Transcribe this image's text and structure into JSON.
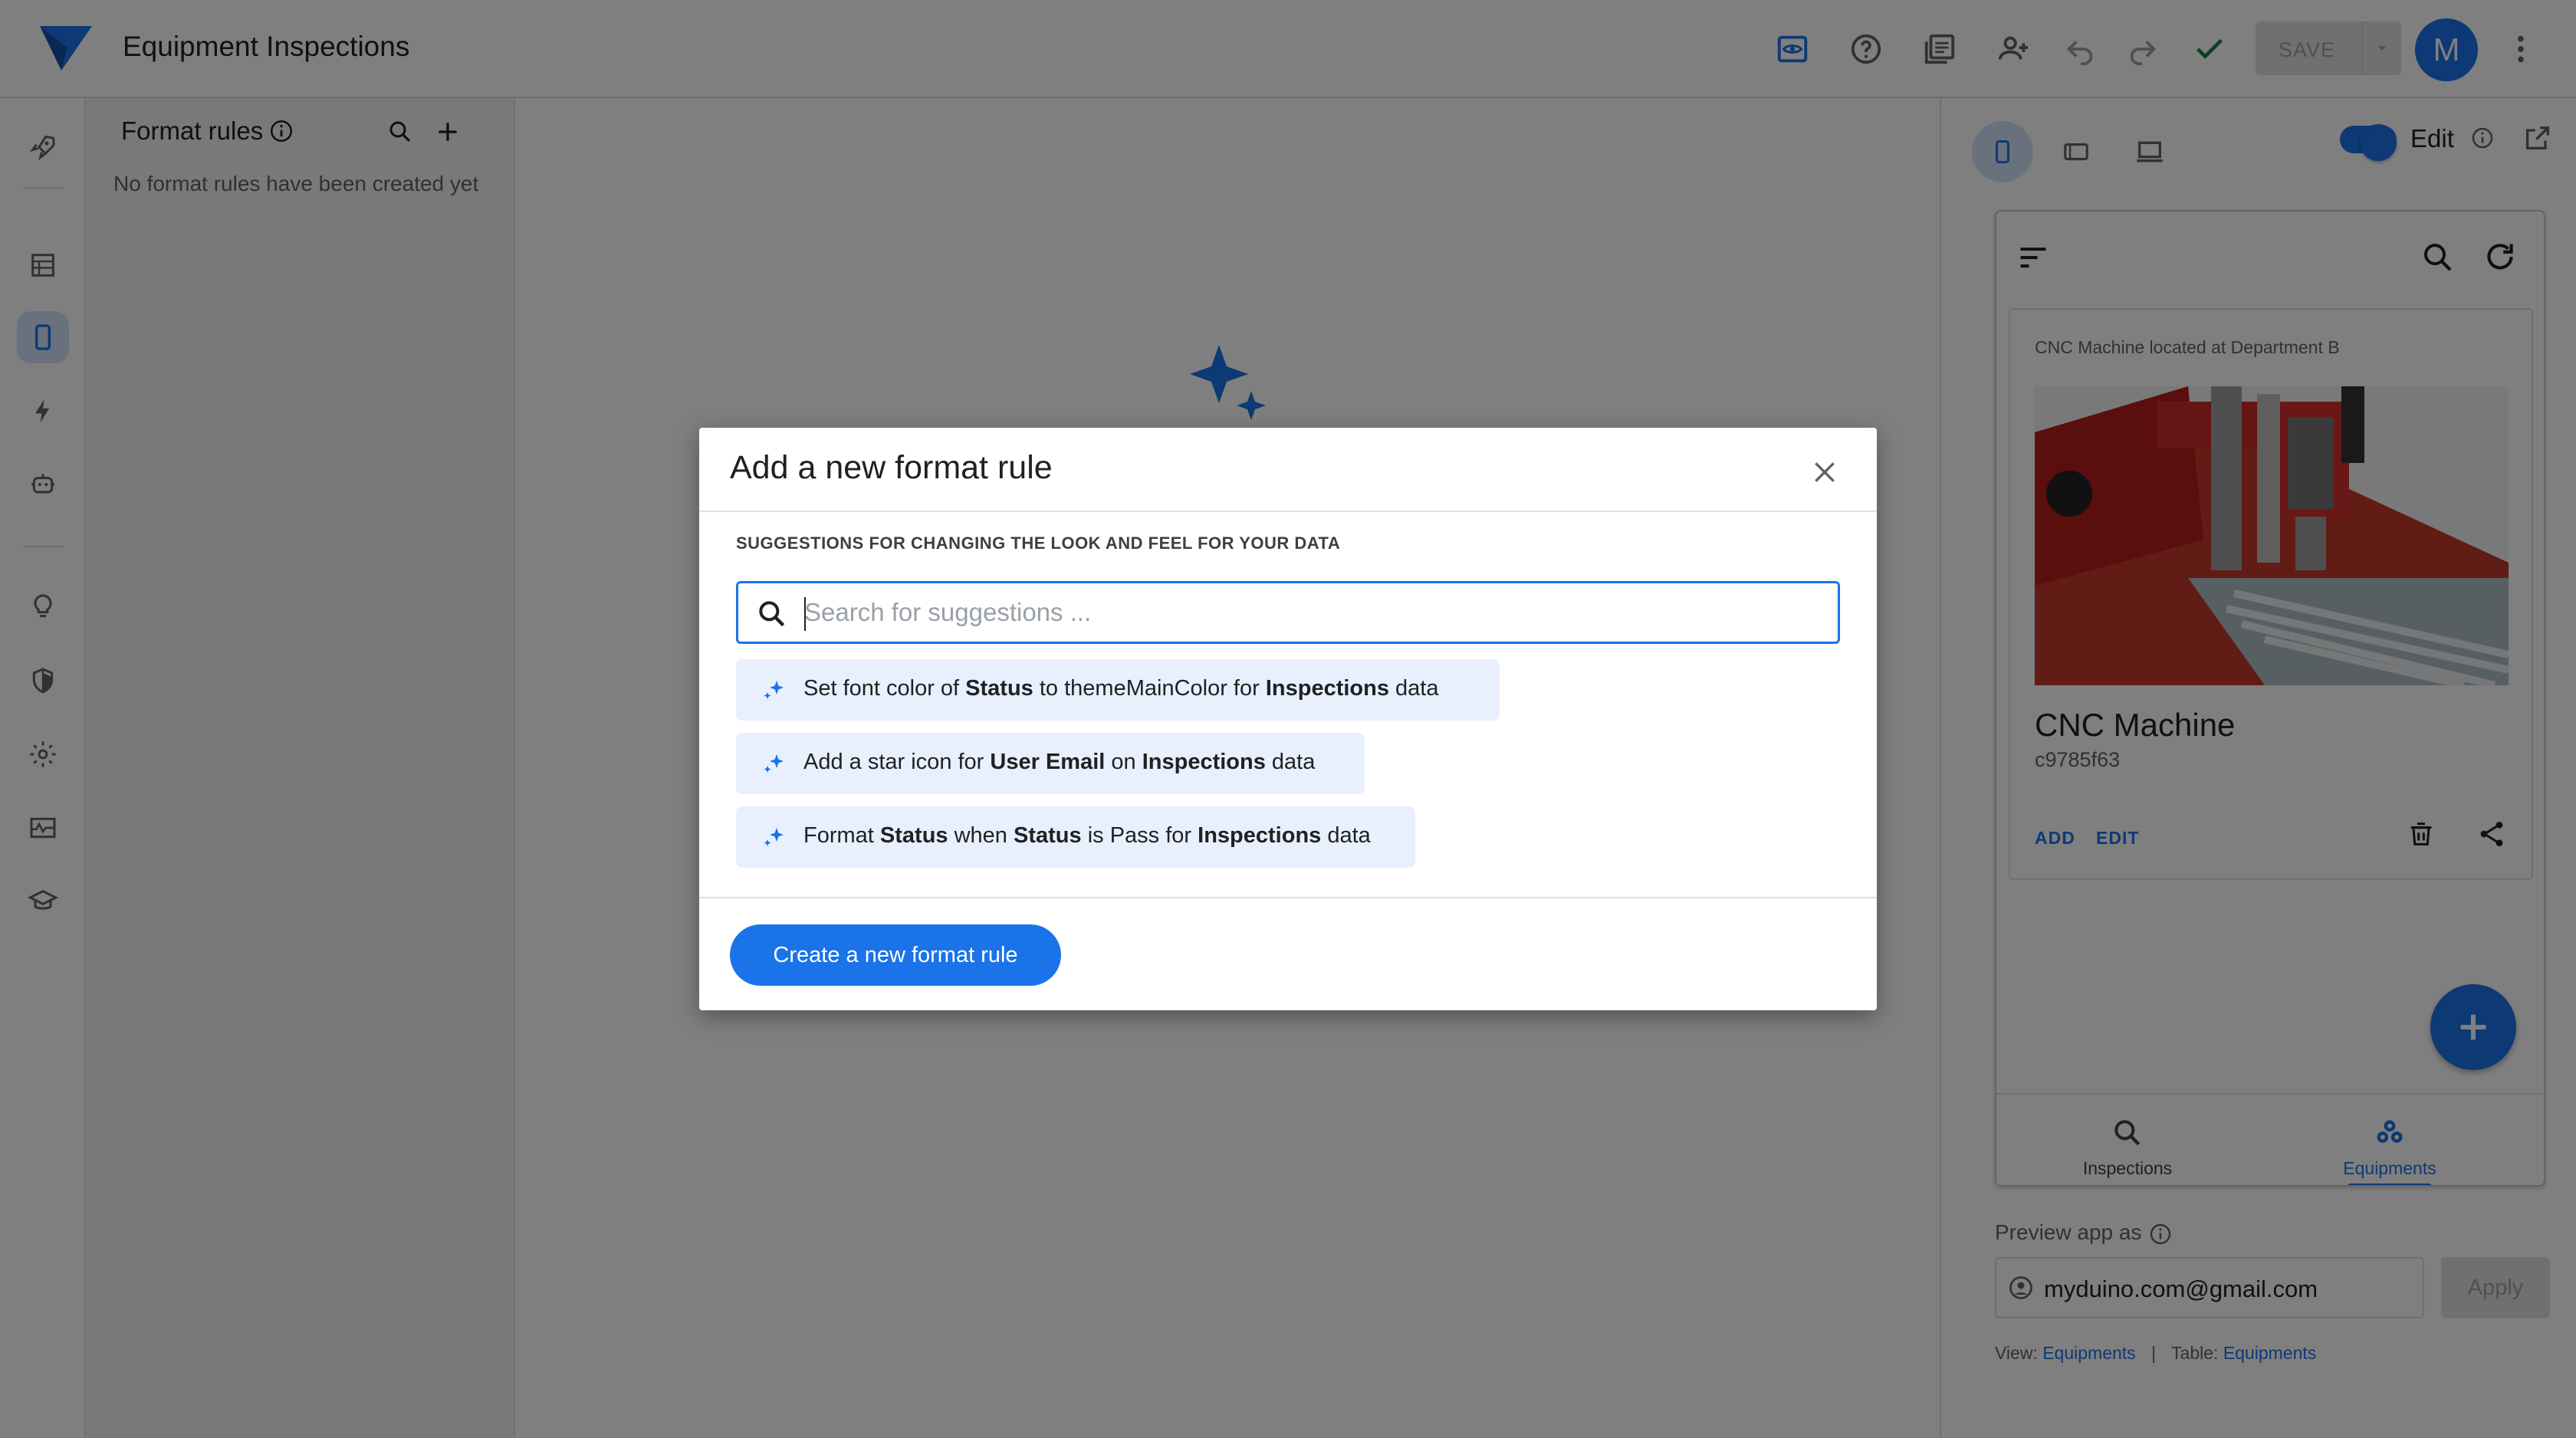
{
  "app": {
    "title": "Equipment Inspections",
    "save_label": "SAVE",
    "avatar_initial": "M",
    "accent_color": "#1a73e8"
  },
  "toolbar": {
    "icons": [
      "preview-icon",
      "help-icon",
      "docs-icon",
      "share-user-icon",
      "undo-icon",
      "redo-icon",
      "check-icon",
      "more-vert-icon"
    ]
  },
  "rail": {
    "items": [
      "rocket-icon",
      "data-icon",
      "views-icon",
      "automation-icon",
      "bots-icon",
      "ideas-icon",
      "security-icon",
      "settings-icon",
      "monitor-icon",
      "learn-icon"
    ]
  },
  "format_rules": {
    "title": "Format rules",
    "empty_text": "No format rules have been created yet"
  },
  "preview": {
    "edit_label": "Edit",
    "card": {
      "subtitle": "CNC Machine located at Department B",
      "title": "CNC Machine",
      "id": "c9785f63",
      "add_label": "ADD",
      "edit_label": "EDIT"
    },
    "nav": [
      {
        "label": "Inspections",
        "icon": "search-icon"
      },
      {
        "label": "Equipments",
        "icon": "equipments-icon"
      }
    ],
    "preview_as_label": "Preview app as",
    "email": "myduino.com@gmail.com",
    "apply_label": "Apply",
    "view_label": "View:",
    "view_value": "Equipments",
    "separator": "|",
    "table_label": "Table:",
    "table_value": "Equipments"
  },
  "dialog": {
    "title": "Add a new format rule",
    "subtitle": "SUGGESTIONS FOR CHANGING THE LOOK AND FEEL FOR YOUR DATA",
    "search_placeholder": "Search for suggestions ...",
    "search_value": "",
    "suggestions": [
      {
        "parts": [
          "Set font color of ",
          "Status",
          " to themeMainColor for ",
          "Inspections",
          " data"
        ]
      },
      {
        "parts": [
          "Add a star icon for ",
          "User Email",
          " on ",
          "Inspections",
          " data"
        ]
      },
      {
        "parts": [
          "Format ",
          "Status",
          " when ",
          "Status",
          " is Pass for ",
          "Inspections",
          " data"
        ]
      }
    ],
    "create_label": "Create a new format rule"
  }
}
